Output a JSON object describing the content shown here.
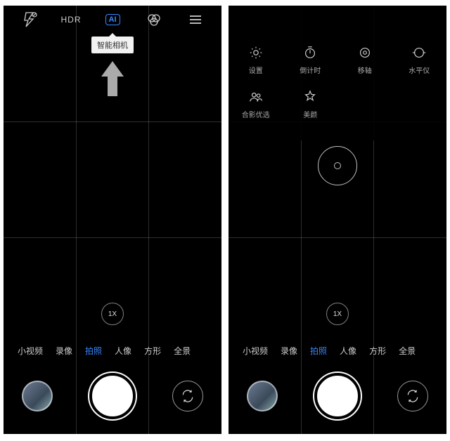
{
  "colors": {
    "accent": "#3a87ff"
  },
  "left": {
    "topbar": {
      "flash": "flash-off-icon",
      "hdr": "HDR",
      "ai": "AI",
      "filter": "filter-icon",
      "menu": "menu-icon"
    },
    "tooltip": "智能相机",
    "zoom": "1X",
    "modes": [
      "小视频",
      "录像",
      "拍照",
      "人像",
      "方形",
      "全景"
    ],
    "modes_active_index": 2
  },
  "right": {
    "quicksettings": [
      {
        "icon": "gear-icon",
        "label": "设置"
      },
      {
        "icon": "timer-icon",
        "label": "倒计时"
      },
      {
        "icon": "tilt-icon",
        "label": "移轴"
      },
      {
        "icon": "level-icon",
        "label": "水平仪"
      },
      {
        "icon": "group-icon",
        "label": "合影优选"
      },
      {
        "icon": "beauty-icon",
        "label": "美颜"
      }
    ],
    "zoom": "1X",
    "modes": [
      "小视频",
      "录像",
      "拍照",
      "人像",
      "方形",
      "全景"
    ],
    "modes_active_index": 2
  }
}
